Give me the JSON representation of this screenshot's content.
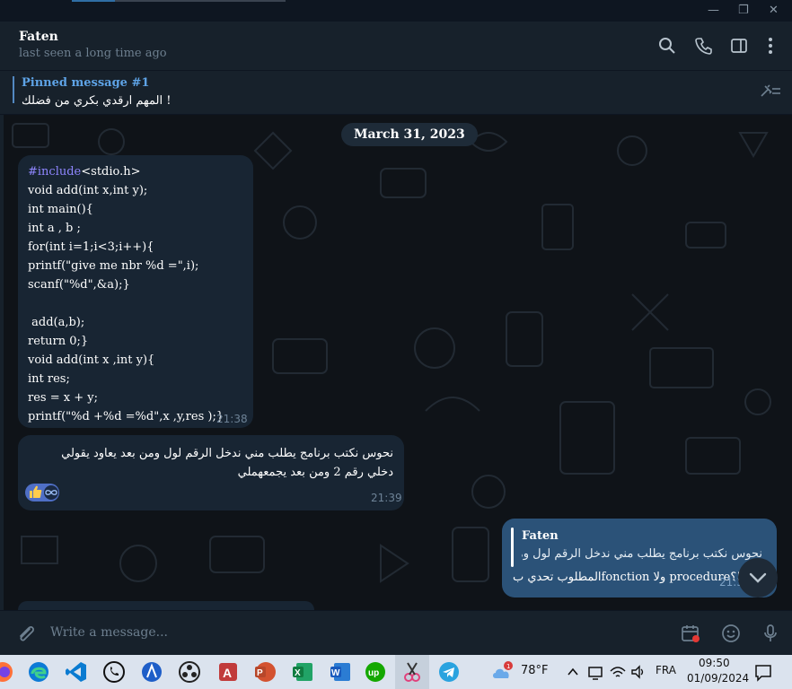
{
  "header": {
    "name": "Faten",
    "status": "last seen a long time ago"
  },
  "pinned": {
    "title": "Pinned message #1",
    "text": "المهم ارقدي بكري من فضلك !"
  },
  "date_pill": "March 31, 2023",
  "messages": {
    "code": {
      "include_keyword": "#include",
      "lines": [
        "<stdio.h>",
        "void add(int x,int y);",
        "int main(){",
        "int a , b ;",
        "for(int i=1;i<3;i++){",
        "printf(\"give me nbr %d =\",i);",
        "scanf(\"%d\",&a);}",
        "",
        " add(a,b);",
        "return 0;}",
        "void add(int x ,int y){",
        "int res;",
        "res = x + y;",
        "printf(\"%d +%d =%d\",x ,y,res );}"
      ],
      "time": "21:38"
    },
    "arabic": {
      "text": "نحوس نكتب برنامج يطلب مني ندخل الرقم لول ومن بعد يعاود يقولي دخلي رقم 2 ومن بعد يجمعهملي",
      "time": "21:39",
      "reaction_icons": [
        "thumbs-up-icon",
        "infinity-icon"
      ]
    },
    "outgoing": {
      "reply_name": "Faten",
      "reply_text": "نحوس نكتب برنامج يطلب مني ندخل الرقم لول ومن بعد...",
      "text": "المطلوب تحدي بfonction ولا procedure؟!",
      "time": "21:3"
    }
  },
  "composer": {
    "placeholder": "Write a message..."
  },
  "taskbar": {
    "weather": "78°F",
    "weather_badge": "1",
    "language": "FRA",
    "time": "09:50",
    "date": "01/09/2024"
  },
  "colors": {
    "header_bg": "#17212b",
    "chat_bg": "#0f1318",
    "incoming_bubble": "#182533",
    "outgoing_bubble": "#2b5278",
    "accent": "#5ea3e6"
  }
}
